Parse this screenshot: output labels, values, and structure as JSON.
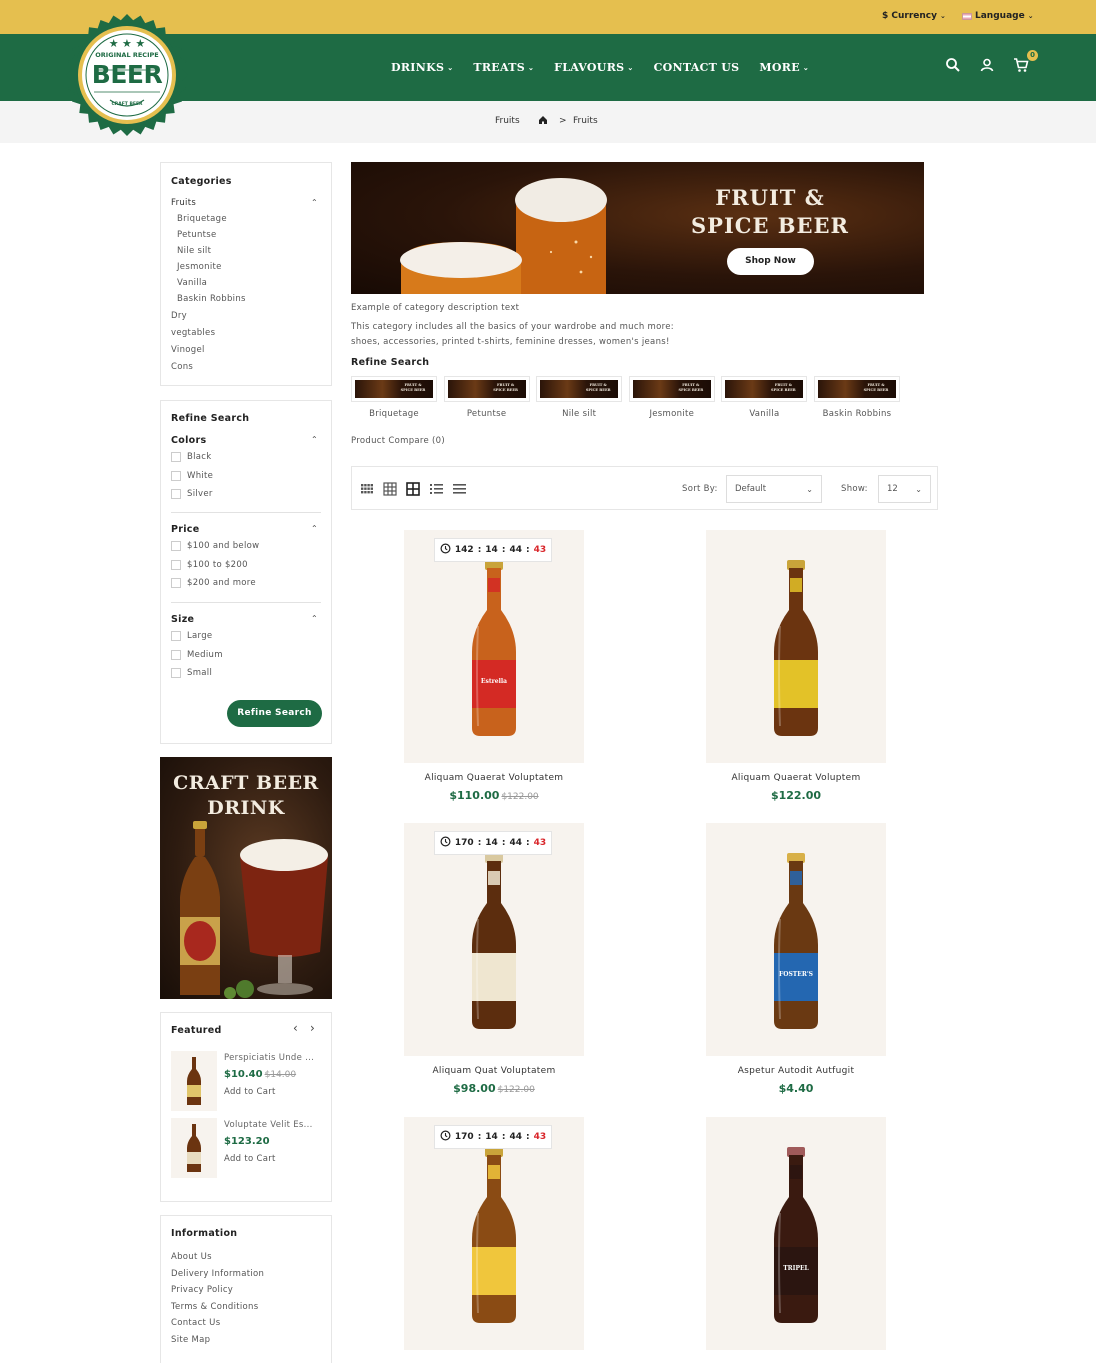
{
  "topbar": {
    "currency_label": "$ Currency",
    "language_label": "Language"
  },
  "logo": {
    "line1": "ORIGINAL RECIPE",
    "line2": "BEER",
    "line3": "CRAFT BEER"
  },
  "nav": {
    "items": [
      {
        "label": "DRINKS",
        "caret": true
      },
      {
        "label": "TREATS",
        "caret": true
      },
      {
        "label": "FLAVOURS",
        "caret": true
      },
      {
        "label": "CONTACT US",
        "caret": false
      },
      {
        "label": "MORE",
        "caret": true
      }
    ],
    "cart_count": "0"
  },
  "breadcrumb": {
    "title": "Fruits",
    "current": "Fruits",
    "separator": ">"
  },
  "categories": {
    "title": "Categories",
    "parent": "Fruits",
    "children": [
      "Briquetage",
      "Petuntse",
      "Nile silt",
      "Jesmonite",
      "Vanilla",
      "Baskin Robbins"
    ],
    "others": [
      "Dry",
      "vegtables",
      "Vinogel",
      "Cons"
    ]
  },
  "filters": {
    "title": "Refine Search",
    "groups": [
      {
        "title": "Colors",
        "options": [
          "Black",
          "White",
          "Silver"
        ]
      },
      {
        "title": "Price",
        "options": [
          "$100 and below",
          "$100 to $200",
          "$200 and more"
        ]
      },
      {
        "title": "Size",
        "options": [
          "Large",
          "Medium",
          "Small"
        ]
      }
    ],
    "button": "Refine Search"
  },
  "side_banner": {
    "line1": "CRAFT BEER",
    "line2": "DRINK"
  },
  "featured": {
    "title": "Featured",
    "items": [
      {
        "name": "Perspiciatis Unde ...",
        "price": "$10.40",
        "old_price": "$14.00",
        "cart": "Add to Cart"
      },
      {
        "name": "Voluptate Velit Es...",
        "price": "$123.20",
        "old_price": "",
        "cart": "Add to Cart"
      }
    ]
  },
  "information": {
    "title": "Information",
    "links": [
      "About Us",
      "Delivery Information",
      "Privacy Policy",
      "Terms & Conditions",
      "Contact Us",
      "Site Map"
    ]
  },
  "banner": {
    "line1": "FRUIT &",
    "line2": "SPICE BEER",
    "button": "Shop Now"
  },
  "description": {
    "line1": "Example of category description text",
    "line2": "This category includes all the basics of your wardrobe and much more:",
    "line3": "shoes, accessories, printed t-shirts, feminine dresses, women's jeans!"
  },
  "refine": {
    "title": "Refine Search",
    "subcats": [
      "Briquetage",
      "Petuntse",
      "Nile silt",
      "Jesmonite",
      "Vanilla",
      "Baskin Robbins"
    ],
    "thumb_caption": "FRUIT & SPICE BEER"
  },
  "compare": "Product Compare (0)",
  "toolbar": {
    "sort_label": "Sort By:",
    "sort_value": "Default",
    "show_label": "Show:",
    "show_value": "12"
  },
  "products": [
    {
      "name": "Aliquam Quaerat Voluptatem",
      "price": "$110.00",
      "old_price": "$122.00",
      "timer": {
        "days": "142",
        "hours": "14",
        "mins": "44",
        "secs": "43"
      },
      "bottle": {
        "body": "#c8621c",
        "label": "#d42a24",
        "label_text": "Estrella",
        "cap": "#c9a43a"
      }
    },
    {
      "name": "Aliquam Quaerat Voluptem",
      "price": "$122.00",
      "old_price": "",
      "timer": null,
      "bottle": {
        "body": "#6b3410",
        "label": "#e3c228",
        "label_text": "",
        "cap": "#c9a43a"
      }
    },
    {
      "name": "Aliquam Quat Voluptatem",
      "price": "$98.00",
      "old_price": "$122.00",
      "timer": {
        "days": "170",
        "hours": "14",
        "mins": "44",
        "secs": "43"
      },
      "bottle": {
        "body": "#5c2d0e",
        "label": "#efe6d0",
        "label_text": "",
        "cap": "#d9c9a0"
      }
    },
    {
      "name": "Aspetur Autodit Autfugit",
      "price": "$4.40",
      "old_price": "",
      "timer": null,
      "bottle": {
        "body": "#6a3912",
        "label": "#2467b1",
        "label_text": "FOSTER'S",
        "cap": "#d8b048"
      }
    },
    {
      "name": "",
      "price": "",
      "old_price": "",
      "timer": {
        "days": "170",
        "hours": "14",
        "mins": "44",
        "secs": "43"
      },
      "bottle": {
        "body": "#8a4b14",
        "label": "#f0c63c",
        "label_text": "",
        "cap": "#c9a43a"
      }
    },
    {
      "name": "",
      "price": "",
      "old_price": "",
      "timer": null,
      "bottle": {
        "body": "#3a1a10",
        "label": "#2b1510",
        "label_text": "TRIPEL",
        "cap": "#a05a5a"
      }
    }
  ],
  "colors": {
    "topbar": "#e5bf4f",
    "nav": "#1e6b44",
    "accent_green": "#1e6b44",
    "sale_red": "#d9262b"
  }
}
